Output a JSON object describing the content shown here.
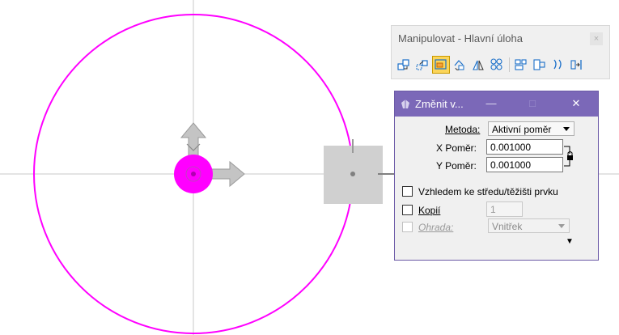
{
  "toolbox": {
    "title": "Manipulovat - Hlavní úloha",
    "close_glyph": "×",
    "tools": [
      {
        "name": "copy-tool-icon",
        "active": false
      },
      {
        "name": "move-tool-icon",
        "active": false
      },
      {
        "name": "scale-tool-icon",
        "active": true
      },
      {
        "name": "rotate-tool-icon",
        "active": false
      },
      {
        "name": "mirror-tool-icon",
        "active": false
      },
      {
        "name": "array-tool-icon",
        "active": false
      },
      {
        "name": "align-edges-tool-icon",
        "active": false
      },
      {
        "name": "stretch-tool-icon",
        "active": false
      },
      {
        "name": "spin-tool-icon",
        "active": false
      },
      {
        "name": "move-to-contact-tool-icon",
        "active": false
      }
    ]
  },
  "dialog": {
    "title": "Změnit v...",
    "minimize_glyph": "—",
    "maximize_glyph": "□",
    "close_glyph": "✕",
    "method": {
      "label": "Metoda:",
      "value": "Aktivní poměr"
    },
    "x_ratio": {
      "label": "X Poměr:",
      "value": "0.001000"
    },
    "y_ratio": {
      "label": "Y Poměr:",
      "value": "0.001000"
    },
    "about_center": {
      "label": "Vzhledem ke středu/těžišti prvku",
      "checked": false
    },
    "copies": {
      "label": "Kopií",
      "checked": false,
      "value": "1"
    },
    "fence": {
      "label": "Ohrada:",
      "checked": false,
      "value": "Vnitřek"
    },
    "expand_glyph": "▼"
  },
  "colors": {
    "accent_magenta": "#ff00ff",
    "title_bar": "#7b68b8",
    "active_tool": "#fbd55a"
  }
}
